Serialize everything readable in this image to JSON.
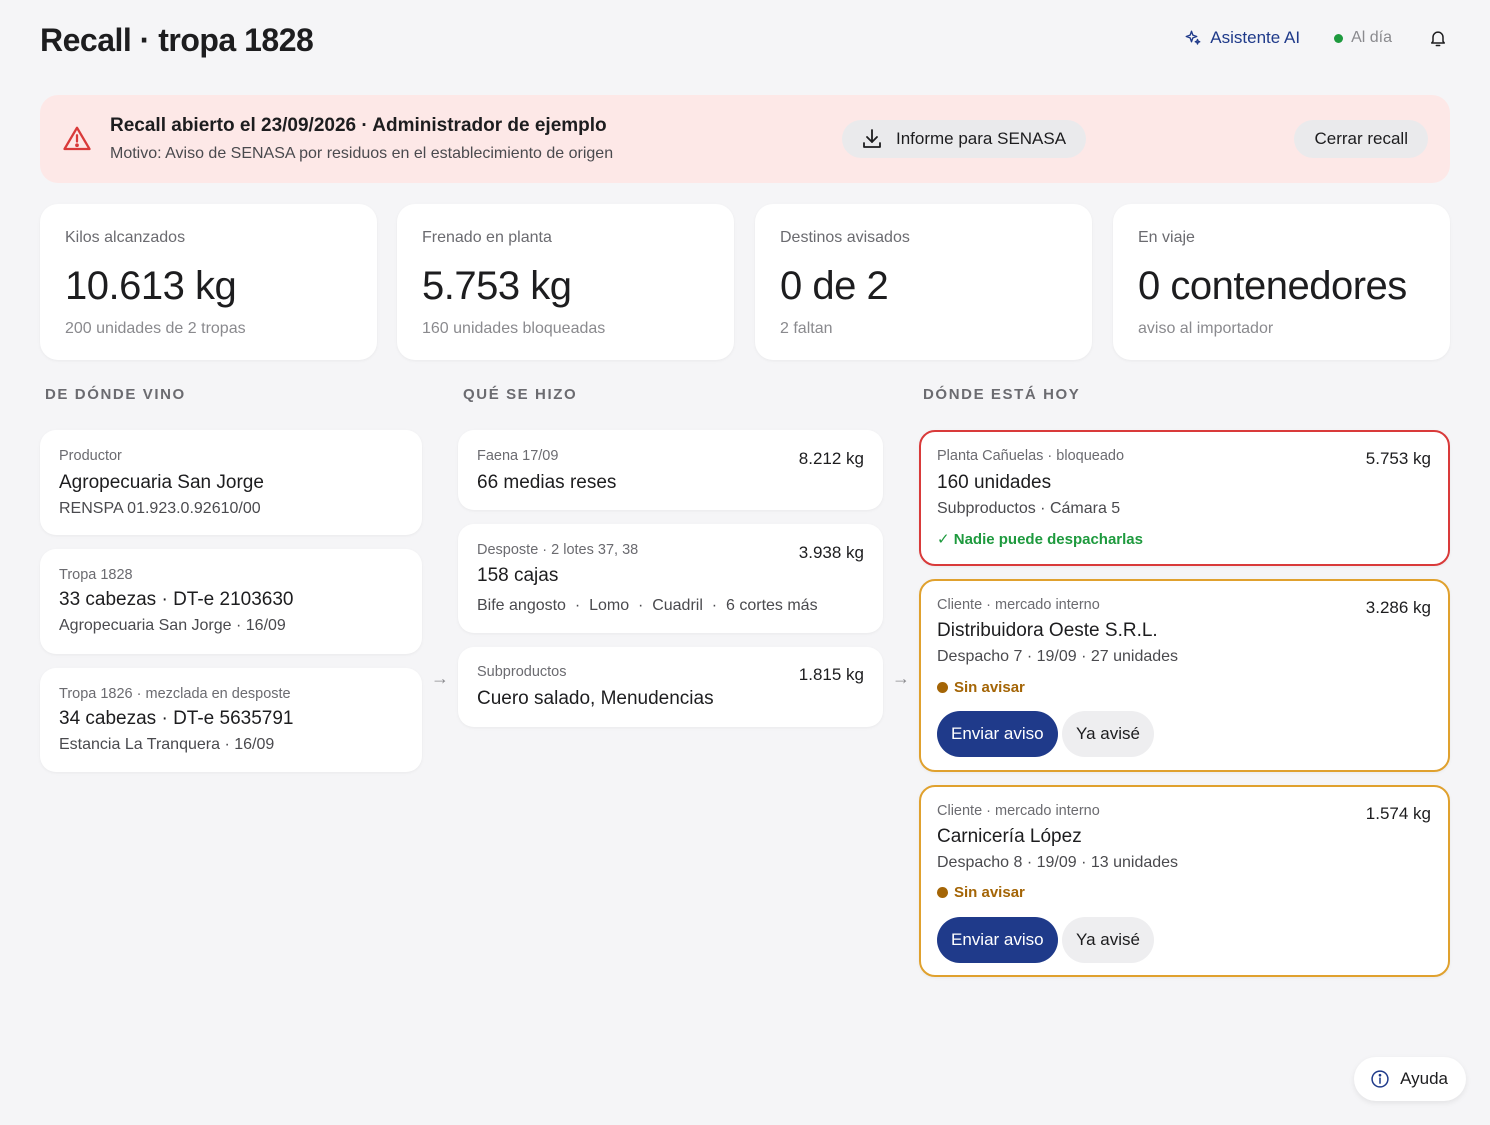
{
  "header": {
    "title": "Recall · tropa 1828",
    "assistant_label": "Asistente AI",
    "status_label": "Al día"
  },
  "banner": {
    "title": "Recall abierto el 23/09/2026 · Administrador de ejemplo",
    "subtitle": "Motivo: Aviso de SENASA por residuos en el establecimiento de origen",
    "report_button": "Informe para SENASA",
    "close_button": "Cerrar recall"
  },
  "stats": [
    {
      "label": "Kilos alcanzados",
      "value": "10.613 kg",
      "sub": "200 unidades de 2 tropas"
    },
    {
      "label": "Frenado en planta",
      "value": "5.753 kg",
      "sub": "160 unidades bloqueadas"
    },
    {
      "label": "Destinos avisados",
      "value": "0 de 2",
      "sub": "2 faltan"
    },
    {
      "label": "En viaje",
      "value": "0 contenedores",
      "sub": "aviso al importador"
    }
  ],
  "sections": {
    "origin": "DE DÓNDE VINO",
    "process": "QUÉ SE HIZO",
    "destination": "DÓNDE ESTÁ HOY"
  },
  "origin": [
    {
      "small": "Productor",
      "title": "Agropecuaria San Jorge",
      "sub": "RENSPA 01.923.0.92610/00"
    },
    {
      "small": "Tropa 1828",
      "title": "33 cabezas · DT-e 2103630",
      "sub": "Agropecuaria San Jorge · 16/09"
    },
    {
      "small": "Tropa 1826 · mezclada en desposte",
      "title": "34 cabezas · DT-e 5635791",
      "sub": "Estancia La Tranquera · 16/09"
    }
  ],
  "process": [
    {
      "small": "Faena 17/09",
      "title": "66 medias reses",
      "weight": "8.212 kg"
    },
    {
      "small": "Desposte · 2 lotes 37, 38",
      "title": "158 cajas",
      "weight": "3.938 kg",
      "sub": "Bife angosto  ·  Lomo  ·  Cuadril  ·  6 cortes más"
    },
    {
      "small": "Subproductos",
      "title": "Cuero salado, Menudencias",
      "weight": "1.815 kg"
    }
  ],
  "destinations": [
    {
      "small": "Planta Cañuelas · bloqueado",
      "title": "160 unidades",
      "sub": "Subproductos · Cámara 5",
      "weight": "5.753 kg",
      "status": "✓ Nadie puede despacharlas"
    },
    {
      "small": "Cliente · mercado interno",
      "title": "Distribuidora Oeste S.R.L.",
      "sub": "Despacho 7 · 19/09 · 27 unidades",
      "weight": "3.286 kg",
      "status": "Sin avisar",
      "send": "Enviar aviso",
      "done": "Ya avisé"
    },
    {
      "small": "Cliente · mercado interno",
      "title": "Carnicería López",
      "sub": "Despacho 8 · 19/09 · 13 unidades",
      "weight": "1.574 kg",
      "status": "Sin avisar",
      "send": "Enviar aviso",
      "done": "Ya avisé"
    }
  ],
  "arrows": {
    "symbol": "→"
  },
  "help": {
    "label": "Ayuda"
  },
  "colors": {
    "accent": "#1f3a8a",
    "danger": "#d93a3a",
    "warning": "#e0a12e",
    "success": "#1e9a3e",
    "banner_bg": "#fde8e7"
  }
}
